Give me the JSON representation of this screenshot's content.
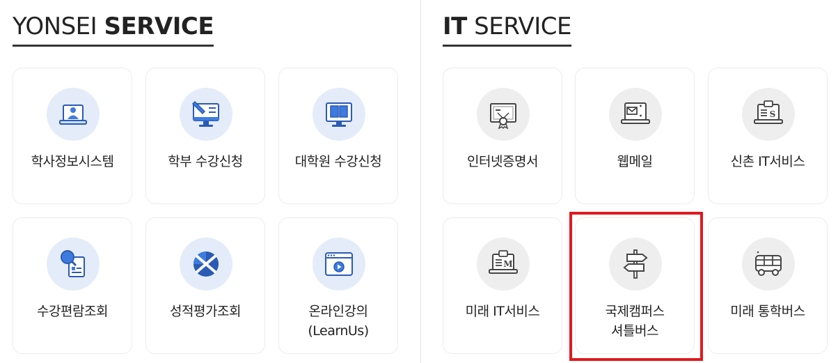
{
  "yonsei": {
    "heading_light": "YONSEI",
    "heading_bold": "SERVICE",
    "items": [
      {
        "label": "학사정보시스템",
        "icon": "presenter-laptop-icon"
      },
      {
        "label": "학부 수강신청",
        "icon": "monitor-pen-icon"
      },
      {
        "label": "대학원 수강신청",
        "icon": "monitor-book-icon"
      },
      {
        "label": "수강편람조회",
        "icon": "magnifier-document-icon"
      },
      {
        "label": "성적평가조회",
        "icon": "grade-chart-icon"
      },
      {
        "label_line1": "온라인강의",
        "label_line2": "(LearnUs)",
        "icon": "video-play-window-icon"
      }
    ]
  },
  "it": {
    "heading_bold": "IT",
    "heading_light": "SERVICE",
    "items": [
      {
        "label": "인터넷증명서",
        "icon": "certificate-icon"
      },
      {
        "label": "웹메일",
        "icon": "laptop-mail-icon"
      },
      {
        "label": "신촌 IT서비스",
        "icon": "laptop-s-service-icon"
      },
      {
        "label": "미래 IT서비스",
        "icon": "laptop-m-service-icon"
      },
      {
        "label_line1": "국제캠퍼스",
        "label_line2": "셔틀버스",
        "icon": "signpost-icon"
      },
      {
        "label": "미래 통학버스",
        "icon": "bus-icon"
      }
    ]
  },
  "colors": {
    "accent_blue": "#2b5bb3",
    "icon_blue_bg": "#e4ecfa",
    "icon_gray_bg": "#eeeeee",
    "highlight_red": "#e0191e"
  }
}
